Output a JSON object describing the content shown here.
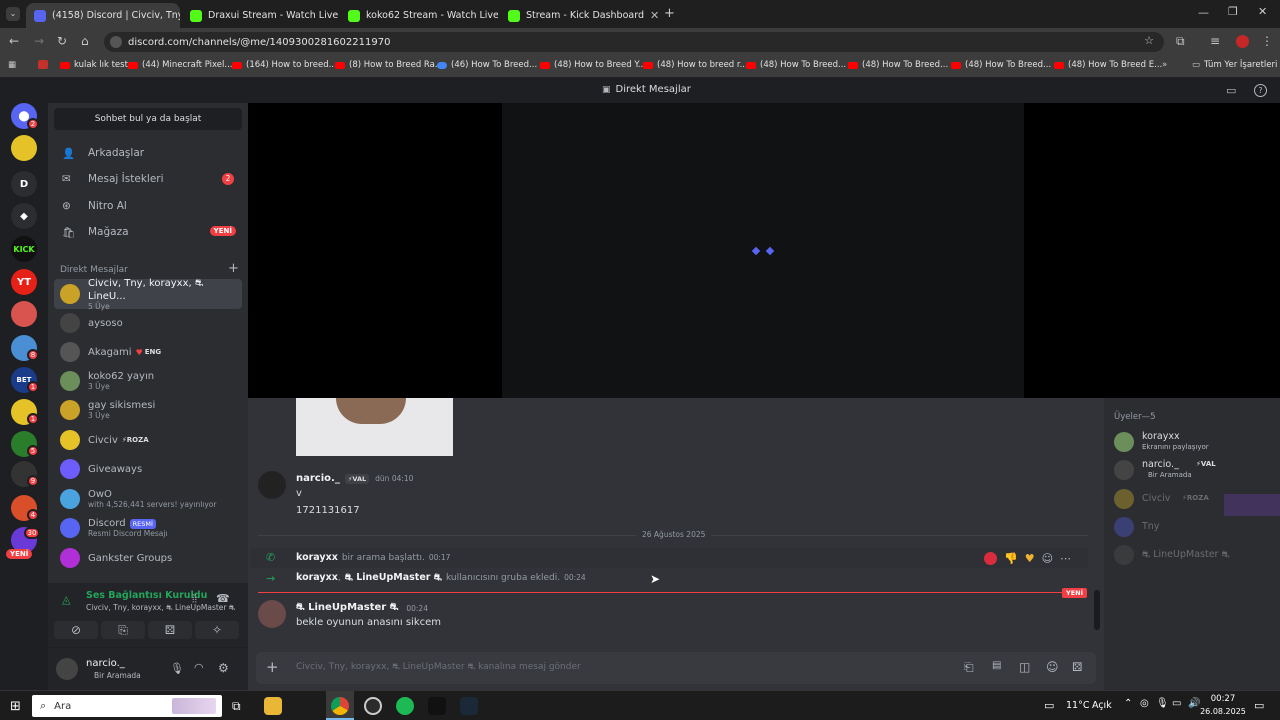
{
  "browser": {
    "tabs": [
      {
        "label": "(4158) Discord | Civciv, Tny,",
        "color": "#5865f2",
        "active": true
      },
      {
        "label": "Draxui Stream - Watch Live on",
        "color": "#53fc18",
        "active": false
      },
      {
        "label": "koko62 Stream - Watch Live on",
        "color": "#53fc18",
        "active": false
      },
      {
        "label": "Stream - Kick Dashboard",
        "color": "#53fc18",
        "active": false
      }
    ],
    "url": "discord.com/channels/@me/1409300281602211970",
    "bookmarks": [
      {
        "label": "kulak lık test",
        "type": "yt"
      },
      {
        "label": "(44) Minecraft Pixel...",
        "type": "yt"
      },
      {
        "label": "(164) How to breed...",
        "type": "yt"
      },
      {
        "label": "(8) How to Breed Ra...",
        "type": "yt"
      },
      {
        "label": "(46) How To Breed...",
        "type": "g"
      },
      {
        "label": "(48) How to Breed Y...",
        "type": "yt"
      },
      {
        "label": "(48) How to breed r...",
        "type": "yt"
      },
      {
        "label": "(48) How To Breed...",
        "type": "yt"
      },
      {
        "label": "(48) How To Breed...",
        "type": "yt"
      },
      {
        "label": "(48) How To Breed...",
        "type": "yt"
      },
      {
        "label": "(48) How To Breed E...",
        "type": "yt"
      }
    ],
    "all_bookmarks": "Tüm Yer İşaretleri"
  },
  "discord": {
    "title": "Direkt Mesajlar",
    "search": "Sohbet bul ya da başlat",
    "nav": [
      {
        "label": "Arkadaşlar",
        "icon": "friends-icon",
        "badge": ""
      },
      {
        "label": "Mesaj İstekleri",
        "icon": "mail-icon",
        "badge": "2"
      },
      {
        "label": "Nitro Al",
        "icon": "nitro-icon",
        "badge": ""
      },
      {
        "label": "Mağaza",
        "icon": "shop-icon",
        "badge": "YENİ"
      }
    ],
    "dm_header": "Direkt Mesajlar",
    "dms": [
      {
        "name": "Civciv, Tny, korayxx, ⛐ LineU...",
        "sub": "5 Üye",
        "color": "#c9a227",
        "tag": ""
      },
      {
        "name": "aysoso",
        "sub": "",
        "color": "#444",
        "tag": ""
      },
      {
        "name": "Akagami",
        "sub": "",
        "color": "#555",
        "tag": "ENG"
      },
      {
        "name": "koko62 yayın",
        "sub": "3 Üye",
        "color": "#6b8e5a",
        "tag": ""
      },
      {
        "name": "gay sikismesi",
        "sub": "3 Üye",
        "color": "#c9a227",
        "tag": ""
      },
      {
        "name": "Civciv",
        "sub": "",
        "color": "#e6c229",
        "tag": "ROZA"
      },
      {
        "name": "Giveaways",
        "sub": "",
        "color": "#6d5dfc",
        "tag": ""
      },
      {
        "name": "OwO",
        "sub": "with 4,526,441 servers! yayınlıyor",
        "color": "#4aa3df",
        "tag": ""
      },
      {
        "name": "Discord",
        "sub": "Resmi Discord Mesajı",
        "color": "#5865f2",
        "tag": "RESMİ"
      },
      {
        "name": "Gankster Groups",
        "sub": "",
        "color": "#b02fd6",
        "tag": ""
      }
    ],
    "voice": {
      "status": "Ses Bağlantısı Kuruldu",
      "channel": "Civciv, Tny, korayxx, ⛐ LineUpMaster ⛐"
    },
    "user": {
      "name": "narcio._",
      "status": "Bir Aramada"
    },
    "servers": [
      {
        "label": "",
        "color": "#5865f2",
        "badge": "2"
      },
      {
        "label": "",
        "color": "#e6c229",
        "badge": ""
      },
      {
        "label": "D",
        "color": "#2b2d31",
        "badge": ""
      },
      {
        "label": "",
        "color": "#2b2d31",
        "badge": ""
      },
      {
        "label": "KICK",
        "color": "#111",
        "badge": ""
      },
      {
        "label": "YT",
        "color": "#e62117",
        "badge": ""
      },
      {
        "label": "",
        "color": "#d9534f",
        "badge": ""
      },
      {
        "label": "",
        "color": "#4a8fd4",
        "badge": "8"
      },
      {
        "label": "BET",
        "color": "#1a3a8a",
        "badge": "1"
      },
      {
        "label": "",
        "color": "#e6c229",
        "badge": "1"
      },
      {
        "label": "",
        "color": "#2a7d2a",
        "badge": "5"
      },
      {
        "label": "",
        "color": "#333",
        "badge": "9"
      },
      {
        "label": "",
        "color": "#d94f2a",
        "badge": "4"
      },
      {
        "label": "",
        "color": "#6a3ad9",
        "badge": "30"
      }
    ],
    "new_badge": "YENİ",
    "messages": {
      "m1_name": "narcio._",
      "m1_tag": "VAL",
      "m1_time": "dün 04:10",
      "m1_line1": "v",
      "m1_line2": "1721131617",
      "date_divider": "26 Ağustos 2025",
      "sys1_name": "korayxx",
      "sys1_text": "bir arama başlattı.",
      "sys1_time": "00:17",
      "sys2_name": "korayxx",
      "sys2_sep": ",",
      "sys2_target": "⛐ LineUpMaster ⛐",
      "sys2_text": "kullanıcısını gruba ekledi.",
      "sys2_time": "00:24",
      "new_label": "YENİ",
      "m2_name": "⛐ LineUpMaster ⛐",
      "m2_time": "00:24",
      "m2_text": "bekle oyunun anasını sikcem"
    },
    "composer_placeholder": "Civciv, Tny, korayxx, ⛐ LineUpMaster ⛐ kanalına mesaj gönder",
    "members_header": "Üyeler—5",
    "members": [
      {
        "name": "korayxx",
        "status": "Ekranını paylaşıyor",
        "color": "#6b8e5a",
        "tag": "",
        "dim": false
      },
      {
        "name": "narcio._",
        "status": "Bir Aramada",
        "color": "#444",
        "tag": "VAL",
        "dim": false
      },
      {
        "name": "Civciv",
        "status": "",
        "color": "#e6c229",
        "tag": "ROZA",
        "dim": true
      },
      {
        "name": "Tny",
        "status": "",
        "color": "#5865f2",
        "tag": "",
        "dim": true
      },
      {
        "name": "⛐ LineUpMaster ⛐",
        "status": "",
        "color": "#555",
        "tag": "",
        "dim": true
      }
    ]
  },
  "taskbar": {
    "search": "Ara",
    "weather": "11°C",
    "weather_text": "Açık",
    "time": "00:27",
    "date": "26.08.2025"
  }
}
